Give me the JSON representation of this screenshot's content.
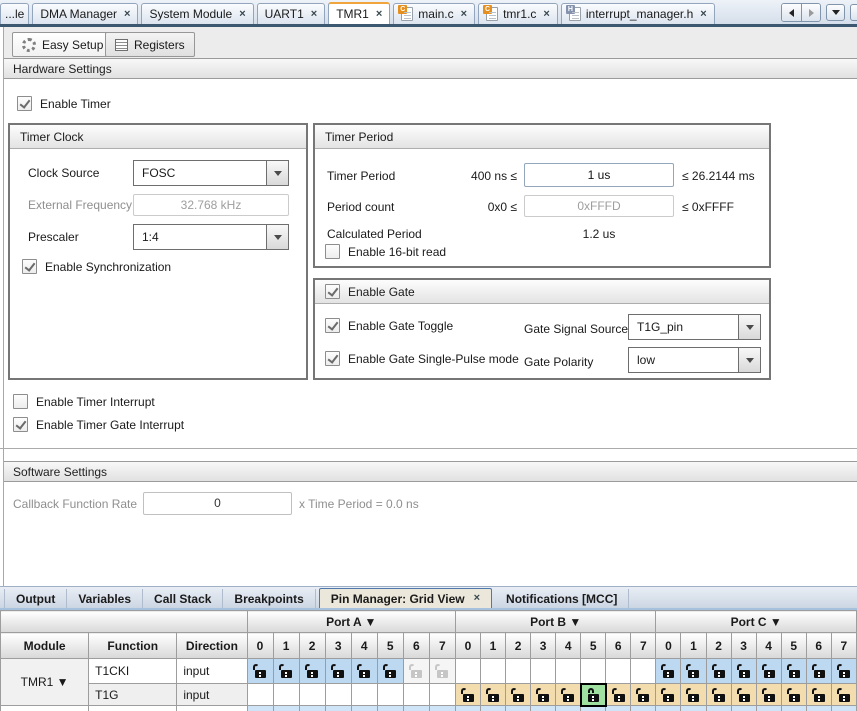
{
  "colors": {
    "pin_available_blue": "#bdd9f2",
    "pin_selectable_tan": "#f3dcae",
    "pin_locked_green": "#9fdf9f",
    "active_tab_accent": "#f0a43c"
  },
  "editor_tabs": {
    "overflow_tab": "...le",
    "tabs": [
      {
        "label": "DMA Manager",
        "icon": null,
        "active": false
      },
      {
        "label": "System Module",
        "icon": null,
        "active": false
      },
      {
        "label": "UART1",
        "icon": null,
        "active": false
      },
      {
        "label": "TMR1",
        "icon": null,
        "active": true
      },
      {
        "label": "main.c",
        "icon": "c",
        "active": false
      },
      {
        "label": "tmr1.c",
        "icon": "c",
        "active": false
      },
      {
        "label": "interrupt_manager.h",
        "icon": "h",
        "active": false
      }
    ]
  },
  "view_toolbar": {
    "easy_setup_label": "Easy Setup",
    "registers_label": "Registers"
  },
  "hardware_settings": {
    "title": "Hardware Settings",
    "enable_timer": {
      "label": "Enable Timer",
      "checked": true
    },
    "timer_clock": {
      "title": "Timer Clock",
      "clock_source_label": "Clock Source",
      "clock_source_value": "FOSC",
      "external_frequency_label": "External Frequency",
      "external_frequency_value": "32.768 kHz",
      "prescaler_label": "Prescaler",
      "prescaler_value": "1:4",
      "enable_sync": {
        "label": "Enable Synchronization",
        "checked": true
      }
    },
    "timer_period": {
      "title": "Timer Period",
      "timer_period_row": {
        "label": "Timer Period",
        "min_label": "400 ns ≤",
        "value": "1 us",
        "max_label": "≤ 26.2144 ms"
      },
      "period_count_row": {
        "label": "Period count",
        "min_label": "0x0 ≤",
        "value": "0xFFFD",
        "max_label": "≤ 0xFFFF"
      },
      "calculated_label": "Calculated Period",
      "calculated_value": "1.2 us",
      "enable_16bit": {
        "label": "Enable 16-bit read",
        "checked": false
      }
    },
    "gate": {
      "enable_gate": {
        "label": "Enable Gate",
        "checked": true
      },
      "enable_gate_toggle": {
        "label": "Enable Gate Toggle",
        "checked": true
      },
      "gate_signal_source_label": "Gate Signal Source",
      "gate_signal_source_value": "T1G_pin",
      "enable_single_pulse": {
        "label": "Enable Gate Single-Pulse mode",
        "checked": true
      },
      "gate_polarity_label": "Gate Polarity",
      "gate_polarity_value": "low"
    },
    "enable_timer_interrupt": {
      "label": "Enable Timer Interrupt",
      "checked": false
    },
    "enable_timer_gate_interrupt": {
      "label": "Enable Timer Gate Interrupt",
      "checked": true
    }
  },
  "software_settings": {
    "title": "Software Settings",
    "callback_label": "Callback Function Rate",
    "callback_value": "0",
    "callback_suffix": "x Time Period =  0.0 ns"
  },
  "bottom_tabs": {
    "tabs": [
      {
        "label": "Output",
        "active": false,
        "closable": false
      },
      {
        "label": "Variables",
        "active": false,
        "closable": false
      },
      {
        "label": "Call Stack",
        "active": false,
        "closable": false
      },
      {
        "label": "Breakpoints",
        "active": false,
        "closable": false
      },
      {
        "label": "Pin Manager: Grid View",
        "active": true,
        "closable": true
      },
      {
        "label": "Notifications [MCC]",
        "active": false,
        "closable": false
      }
    ]
  },
  "pin_grid": {
    "header_columns": [
      "Module",
      "Function",
      "Direction"
    ],
    "ports": [
      "Port A ▼",
      "Port B ▼",
      "Port C ▼"
    ],
    "pin_numbers": [
      "0",
      "1",
      "2",
      "3",
      "4",
      "5",
      "6",
      "7"
    ],
    "module_label": "TMR1 ▼",
    "rows": [
      {
        "function": "T1CKI",
        "direction": "input",
        "pins": [
          "blue",
          "blue",
          "blue",
          "blue",
          "blue",
          "blue",
          "disabled",
          "disabled",
          "",
          "",
          "",
          "",
          "",
          "",
          "",
          "",
          "blue",
          "blue",
          "blue",
          "blue",
          "blue",
          "blue",
          "blue",
          "blue"
        ]
      },
      {
        "function": "T1G",
        "direction": "input",
        "pins": [
          "",
          "",
          "",
          "",
          "",
          "",
          "",
          "",
          "tan",
          "tan",
          "tan",
          "tan",
          "tan",
          "locked",
          "tan",
          "tan",
          "tan",
          "tan",
          "tan",
          "tan",
          "tan",
          "tan",
          "tan",
          "tan"
        ]
      }
    ]
  }
}
